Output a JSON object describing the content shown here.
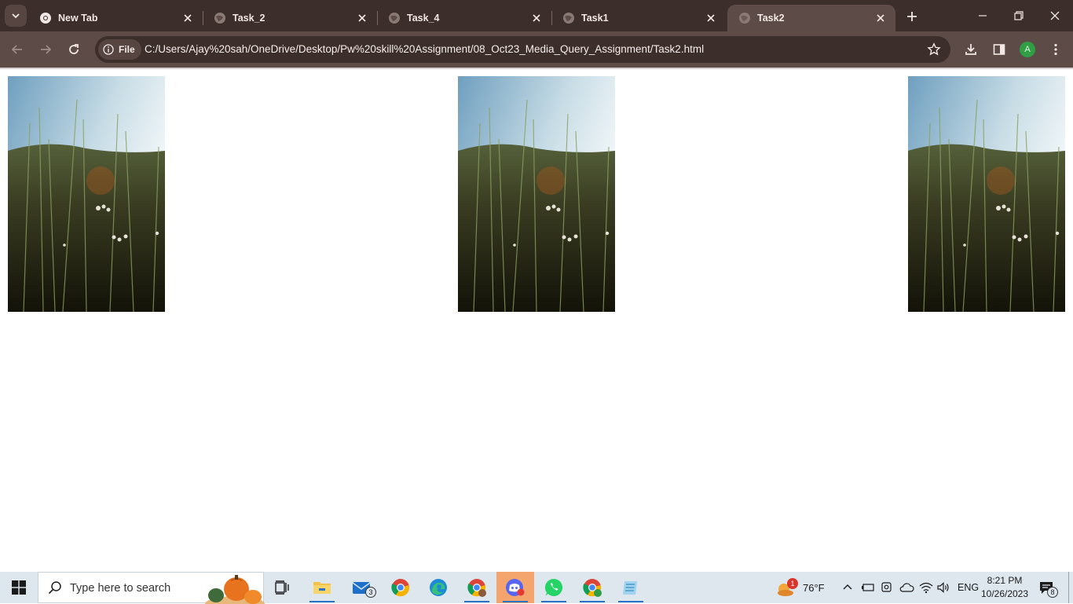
{
  "browser": {
    "tabs": [
      {
        "title": "New Tab",
        "icon": "chrome-icon",
        "active": false
      },
      {
        "title": "Task_2",
        "icon": "globe-icon",
        "active": false
      },
      {
        "title": "Task_4",
        "icon": "globe-icon",
        "active": false
      },
      {
        "title": "Task1",
        "icon": "globe-icon",
        "active": false
      },
      {
        "title": "Task2",
        "icon": "globe-icon",
        "active": true
      }
    ],
    "address_bar": {
      "scheme_chip": "File",
      "url": "C:/Users/Ajay%20sah/OneDrive/Desktop/Pw%20skill%20Assignment/08_Oct23_Media_Query_Assignment/Task2.html"
    },
    "profile_initial": "A"
  },
  "page": {
    "images": [
      {
        "description": "grass field photo"
      },
      {
        "description": "grass field photo"
      },
      {
        "description": "grass field photo"
      }
    ]
  },
  "taskbar": {
    "search_placeholder": "Type here to search",
    "mail_badge": "3",
    "weather": {
      "temperature": "76°F",
      "alert_count": "1"
    },
    "language": "ENG",
    "clock": {
      "time": "8:21 PM",
      "date": "10/26/2023"
    },
    "notification_count": "8"
  },
  "colors": {
    "tab_strip": "#3c2e2a",
    "toolbar": "#5c4b47",
    "taskbar": "#dfe7ee",
    "accent": "#2a73c4"
  }
}
